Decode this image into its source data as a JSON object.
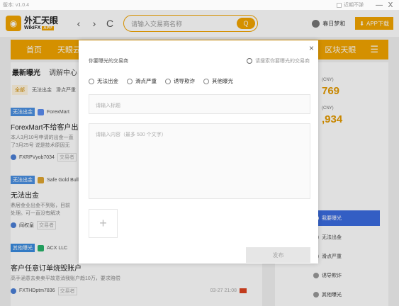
{
  "titlebar": {
    "version": "版本: v1.0.4",
    "no_disturb": "近期不弹",
    "minimize": "—",
    "close": "X"
  },
  "header": {
    "logo_cn": "外汇天眼",
    "logo_en": "WikiFX",
    "logo_badge": "APP",
    "back": "‹",
    "forward": "›",
    "refresh": "C",
    "search_placeholder": "请输入交易商名称",
    "search_btn": "Q",
    "user_name": "春日梦和",
    "download": "APP下载"
  },
  "mainnav": {
    "home": "首页",
    "partial": "天眼云",
    "blockchain": "区块天眼",
    "menu": "☰"
  },
  "feed": {
    "tabs": [
      "最新曝光",
      "调解中心"
    ],
    "filters": [
      "全部",
      "无法出金",
      "滑点严重"
    ],
    "posts": [
      {
        "tag": "无法出金",
        "company": "ForexMart",
        "title": "ForexMart不给客户出金",
        "body1": "本人3月10号申请的出金一直",
        "body2": "了3月25号 说是技术原因无",
        "user": "FXRPVyob7034",
        "role": "交易者"
      },
      {
        "tag": "无法出金",
        "company": "Safe Gold Bull",
        "title": "无法出金",
        "body1": "鼎居金业出金不到账，目前",
        "body2": "处理。可一直没有解决",
        "user": "阎权皇",
        "role": "交易者"
      },
      {
        "tag": "其他曝光",
        "company": "ACX LLC",
        "title": "客户任意订单烧毁账户",
        "body1": "高手涵意去卖卖平故意消我账户趋10万，要求赔偿",
        "user": "FXTHDptm7836",
        "role": "交易者",
        "date": "03-27 21:08"
      }
    ]
  },
  "rightcol": {
    "rate1_label": "(CNY)",
    "rate1_value": "769",
    "rate2_label": "(CNY)",
    "rate2_value": ",934",
    "buttons": [
      "我要曝光",
      "无法出金",
      "滑点严重",
      "诱导欺诈",
      "其他曝光"
    ]
  },
  "modal": {
    "close": "×",
    "title": "你要曝光的交易商",
    "search_placeholder": "请搜索你要曝光的交易商",
    "categories": [
      "无法出金",
      "滑点严重",
      "诱导欺诈",
      "其他曝光"
    ],
    "title_placeholder": "请输入标题",
    "content_placeholder": "请输入内容（最多 500 个文字）",
    "upload": "+",
    "submit": "发布"
  }
}
